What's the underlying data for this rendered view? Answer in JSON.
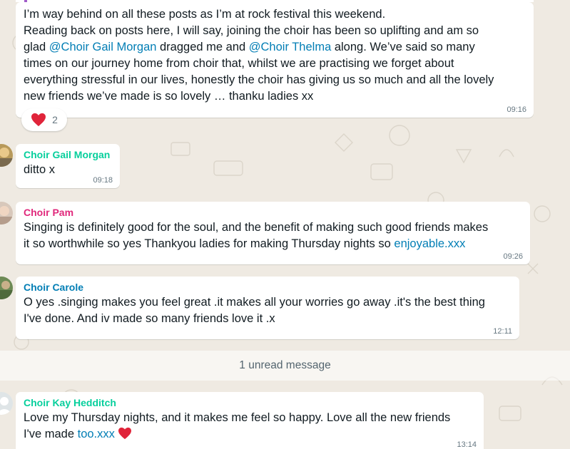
{
  "colors": {
    "background": "#efeae2",
    "bubble": "#ffffff",
    "mention": "#027eb5",
    "sender_gail": "#06cf9c",
    "sender_pam": "#e0287b",
    "sender_carole": "#027eb5",
    "sender_kay": "#06cf9c",
    "heart": "#e0243a"
  },
  "messages": [
    {
      "lines": [
        "I’m way behind on all these posts as I’m at rock festival this weekend.",
        "Reading back on posts here, I will say, joining the choir has been so uplifting and am so"
      ],
      "line3_pre": "glad ",
      "mention1": "@Choir Gail Morgan",
      "line3_mid": " dragged me and ",
      "mention2": "@Choir Thelma",
      "line3_post": " along. We’ve said so many",
      "lines_after": [
        "times on our journey home from choir that, whilst we are practising we forget about",
        "everything stressful in our lives, honestly the choir has giving us so much and all the lovely",
        "new friends we’ve made is so lovely … thanku ladies xx"
      ],
      "time": "09:16",
      "reaction": {
        "icon": "heart-icon",
        "count": "2"
      }
    },
    {
      "sender": "Choir Gail Morgan",
      "text": "ditto x",
      "time": "09:18"
    },
    {
      "sender": "Choir Pam",
      "line1": "Singing is definitely good for the soul, and the benefit of making such good friends makes",
      "line2_pre": "it so worthwhile so yes Thankyou ladies for making Thursday nights so ",
      "link": "enjoyable.xxx",
      "time": "09:26"
    },
    {
      "sender": "Choir Carole",
      "line1": "O yes .singing makes you feel great .it makes all your worries go away .it's the best thing",
      "line2": "I've done. And iv made so many friends love it .x",
      "time": "12:11"
    },
    {
      "sender": "Choir Kay Hedditch",
      "line1": "Love my Thursday nights, and it makes me feel so happy. Love all the new friends",
      "line2_pre": "I've made ",
      "link": "too.xxx",
      "time": "13:14"
    }
  ],
  "unread": "1 unread message"
}
